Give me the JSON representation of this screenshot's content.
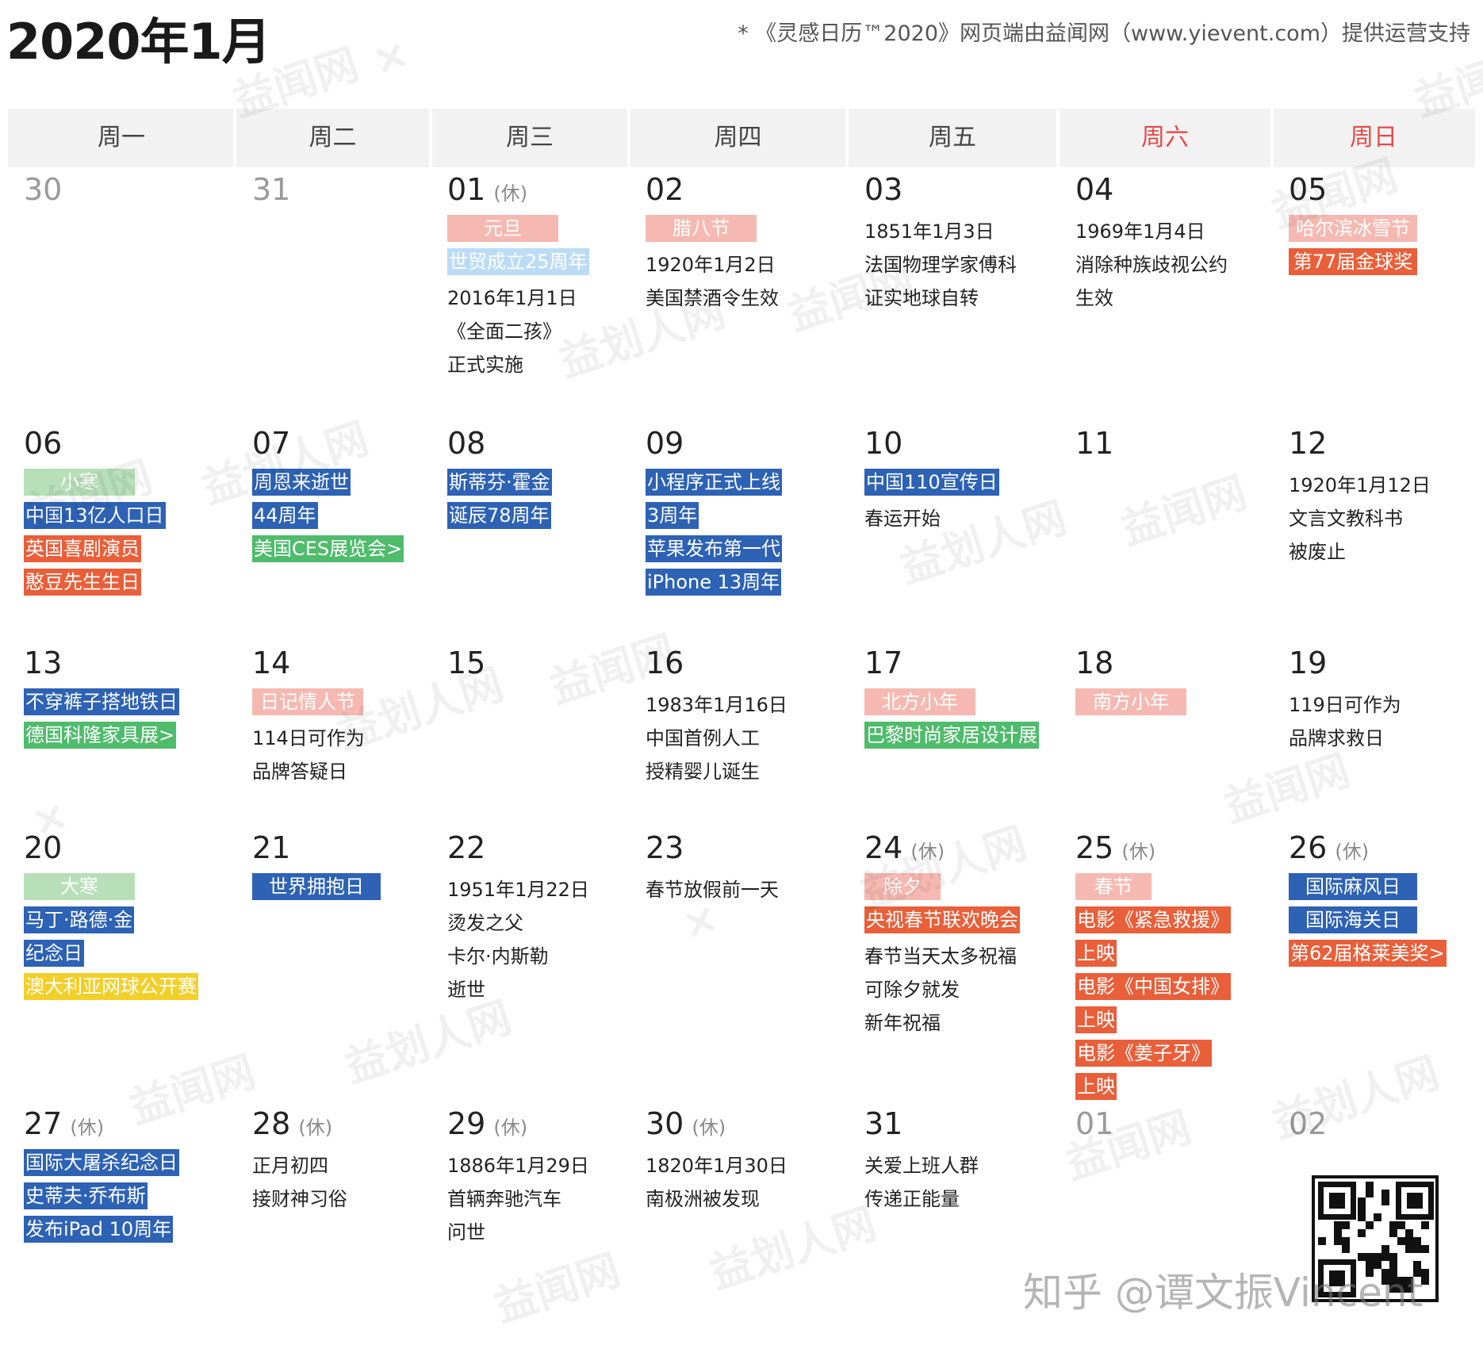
{
  "header": {
    "title": "2020年1月",
    "credit": "* 《灵感日历™2020》网页端由益闻网（www.yievent.com）提供运营支持"
  },
  "colors": {
    "red_tag": "#e95f3a",
    "pink_tag": "#f6b9b2",
    "blue_tag": "#2d62b5",
    "light_blue_tag": "#bcdcf5",
    "green_tag": "#4fbc6c",
    "light_green_tag": "#b7e0b8",
    "yellow_tag": "#f3cf2a",
    "weekend_header": "#e64a4a"
  },
  "weekdays": [
    "周一",
    "周二",
    "周三",
    "周四",
    "周五",
    "周六",
    "周日"
  ],
  "holiday_mark": "(休)",
  "weeks": [
    {
      "days": [
        {
          "num": "30",
          "other": true,
          "items": []
        },
        {
          "num": "31",
          "other": true,
          "items": []
        },
        {
          "num": "01",
          "holiday": true,
          "items": [
            {
              "type": "tag",
              "text": "元旦",
              "color": "#f6b9b2",
              "center": true
            },
            {
              "type": "tag",
              "text": "世贸成立25周年",
              "color": "#bcdcf5"
            },
            {
              "type": "note",
              "text": "2016年1月1日"
            },
            {
              "type": "note",
              "text": "《全面二孩》"
            },
            {
              "type": "note",
              "text": "正式实施"
            }
          ]
        },
        {
          "num": "02",
          "items": [
            {
              "type": "tag",
              "text": "腊八节",
              "color": "#f6b9b2",
              "center": true
            },
            {
              "type": "note",
              "text": "1920年1月2日"
            },
            {
              "type": "note",
              "text": "美国禁酒令生效"
            }
          ]
        },
        {
          "num": "03",
          "items": [
            {
              "type": "note",
              "text": "1851年1月3日"
            },
            {
              "type": "note",
              "text": "法国物理学家傅科"
            },
            {
              "type": "note",
              "text": "证实地球自转"
            }
          ]
        },
        {
          "num": "04",
          "items": [
            {
              "type": "note",
              "text": "1969年1月4日"
            },
            {
              "type": "note",
              "text": "消除种族歧视公约"
            },
            {
              "type": "note",
              "text": "生效"
            }
          ]
        },
        {
          "num": "05",
          "items": [
            {
              "type": "tag",
              "text": "哈尔滨冰雪节",
              "color": "#f6b9b2",
              "center": true,
              "wide": true
            },
            {
              "type": "tag",
              "text": "第77届金球奖",
              "color": "#e95f3a",
              "center": true,
              "wide": true
            }
          ]
        }
      ]
    },
    {
      "days": [
        {
          "num": "06",
          "items": [
            {
              "type": "tag",
              "text": "小寒",
              "color": "#b7e0b8",
              "center": true
            },
            {
              "type": "tag",
              "text": "中国13亿人口日",
              "color": "#2d62b5"
            },
            {
              "type": "tag",
              "text": "英国喜剧演员",
              "color": "#e95f3a"
            },
            {
              "type": "tag",
              "text": "憨豆先生生日",
              "color": "#e95f3a"
            }
          ]
        },
        {
          "num": "07",
          "items": [
            {
              "type": "tag",
              "text": "周恩来逝世",
              "color": "#2d62b5"
            },
            {
              "type": "tag",
              "text": "44周年",
              "color": "#2d62b5"
            },
            {
              "type": "tag",
              "text": "美国CES展览会>",
              "color": "#4fbc6c"
            }
          ]
        },
        {
          "num": "08",
          "items": [
            {
              "type": "tag",
              "text": "斯蒂芬·霍金",
              "color": "#2d62b5"
            },
            {
              "type": "tag",
              "text": "诞辰78周年",
              "color": "#2d62b5"
            }
          ]
        },
        {
          "num": "09",
          "items": [
            {
              "type": "tag",
              "text": "小程序正式上线",
              "color": "#2d62b5"
            },
            {
              "type": "tag",
              "text": "3周年",
              "color": "#2d62b5"
            },
            {
              "type": "tag",
              "text": "苹果发布第一代",
              "color": "#2d62b5"
            },
            {
              "type": "tag",
              "text": "iPhone 13周年",
              "color": "#2d62b5"
            }
          ]
        },
        {
          "num": "10",
          "items": [
            {
              "type": "tag",
              "text": "中国110宣传日",
              "color": "#2d62b5"
            },
            {
              "type": "note",
              "text": "春运开始"
            }
          ]
        },
        {
          "num": "11",
          "items": []
        },
        {
          "num": "12",
          "items": [
            {
              "type": "note",
              "text": "1920年1月12日"
            },
            {
              "type": "note",
              "text": "文言文教科书"
            },
            {
              "type": "note",
              "text": "被废止"
            }
          ]
        }
      ]
    },
    {
      "days": [
        {
          "num": "13",
          "items": [
            {
              "type": "tag",
              "text": "不穿裤子搭地铁日",
              "color": "#2d62b5"
            },
            {
              "type": "tag",
              "text": "德国科隆家具展>",
              "color": "#4fbc6c"
            }
          ]
        },
        {
          "num": "14",
          "items": [
            {
              "type": "tag",
              "text": "日记情人节",
              "color": "#f6b9b2",
              "center": true
            },
            {
              "type": "note",
              "text": "114日可作为"
            },
            {
              "type": "note",
              "text": "品牌答疑日"
            }
          ]
        },
        {
          "num": "15",
          "items": []
        },
        {
          "num": "16",
          "items": [
            {
              "type": "note",
              "text": "1983年1月16日"
            },
            {
              "type": "note",
              "text": "中国首例人工"
            },
            {
              "type": "note",
              "text": "授精婴儿诞生"
            }
          ]
        },
        {
          "num": "17",
          "items": [
            {
              "type": "tag",
              "text": "北方小年",
              "color": "#f6b9b2",
              "center": true
            },
            {
              "type": "tag",
              "text": "巴黎时尚家居设计展",
              "color": "#4fbc6c"
            }
          ]
        },
        {
          "num": "18",
          "items": [
            {
              "type": "tag",
              "text": "南方小年",
              "color": "#f6b9b2",
              "center": true
            }
          ]
        },
        {
          "num": "19",
          "items": [
            {
              "type": "note",
              "text": "119日可作为"
            },
            {
              "type": "note",
              "text": "品牌求救日"
            }
          ]
        }
      ]
    },
    {
      "days": [
        {
          "num": "20",
          "items": [
            {
              "type": "tag",
              "text": "大寒",
              "color": "#b7e0b8",
              "center": true
            },
            {
              "type": "tag",
              "text": "马丁·路德·金",
              "color": "#2d62b5"
            },
            {
              "type": "tag",
              "text": "纪念日",
              "color": "#2d62b5"
            },
            {
              "type": "tag",
              "text": "澳大利亚网球公开赛",
              "color": "#f3cf2a"
            }
          ]
        },
        {
          "num": "21",
          "items": [
            {
              "type": "tag",
              "text": "世界拥抱日",
              "color": "#2d62b5",
              "center": true,
              "wide": true
            }
          ]
        },
        {
          "num": "22",
          "items": [
            {
              "type": "note",
              "text": "1951年1月22日"
            },
            {
              "type": "note",
              "text": "烫发之父"
            },
            {
              "type": "note",
              "text": "卡尔·内斯勒"
            },
            {
              "type": "note",
              "text": "逝世"
            }
          ]
        },
        {
          "num": "23",
          "items": [
            {
              "type": "note",
              "text": "春节放假前一天"
            }
          ]
        },
        {
          "num": "24",
          "holiday": true,
          "items": [
            {
              "type": "tag",
              "text": "除夕",
              "color": "#f6b9b2",
              "center": true,
              "narrow": true
            },
            {
              "type": "tag",
              "text": "央视春节联欢晚会",
              "color": "#e95f3a"
            },
            {
              "type": "note",
              "text": "春节当天太多祝福"
            },
            {
              "type": "note",
              "text": "可除夕就发"
            },
            {
              "type": "note",
              "text": "新年祝福"
            }
          ]
        },
        {
          "num": "25",
          "holiday": true,
          "items": [
            {
              "type": "tag",
              "text": "春节",
              "color": "#f6b9b2",
              "center": true,
              "narrow": true
            },
            {
              "type": "tag",
              "text": "电影《紧急救援》",
              "color": "#e95f3a"
            },
            {
              "type": "tag",
              "text": "上映",
              "color": "#e95f3a"
            },
            {
              "type": "tag",
              "text": "电影《中国女排》",
              "color": "#e95f3a"
            },
            {
              "type": "tag",
              "text": "上映",
              "color": "#e95f3a"
            },
            {
              "type": "tag",
              "text": "电影《姜子牙》",
              "color": "#e95f3a"
            },
            {
              "type": "tag",
              "text": "上映",
              "color": "#e95f3a"
            }
          ]
        },
        {
          "num": "26",
          "holiday": true,
          "items": [
            {
              "type": "tag",
              "text": "国际麻风日",
              "color": "#2d62b5",
              "center": true,
              "wide": true
            },
            {
              "type": "tag",
              "text": "国际海关日",
              "color": "#2d62b5",
              "center": true,
              "wide": true
            },
            {
              "type": "tag",
              "text": "第62届格莱美奖>",
              "color": "#e95f3a"
            }
          ]
        }
      ]
    },
    {
      "days": [
        {
          "num": "27",
          "holiday": true,
          "items": [
            {
              "type": "tag",
              "text": "国际大屠杀纪念日",
              "color": "#2d62b5"
            },
            {
              "type": "tag",
              "text": "史蒂夫·乔布斯",
              "color": "#2d62b5"
            },
            {
              "type": "tag",
              "text": "发布iPad 10周年",
              "color": "#2d62b5"
            }
          ]
        },
        {
          "num": "28",
          "holiday": true,
          "items": [
            {
              "type": "note",
              "text": "正月初四"
            },
            {
              "type": "note",
              "text": "接财神习俗"
            }
          ]
        },
        {
          "num": "29",
          "holiday": true,
          "items": [
            {
              "type": "note",
              "text": "1886年1月29日"
            },
            {
              "type": "note",
              "text": "首辆奔驰汽车"
            },
            {
              "type": "note",
              "text": "问世"
            }
          ]
        },
        {
          "num": "30",
          "holiday": true,
          "items": [
            {
              "type": "note",
              "text": "1820年1月30日"
            },
            {
              "type": "note",
              "text": "南极洲被发现"
            }
          ]
        },
        {
          "num": "31",
          "items": [
            {
              "type": "note",
              "text": "关爱上班人群"
            },
            {
              "type": "note",
              "text": "传递正能量"
            }
          ]
        },
        {
          "num": "01",
          "other": true,
          "items": []
        },
        {
          "num": "02",
          "other": true,
          "items": []
        }
      ]
    }
  ],
  "watermarks": [
    "益闻网",
    "×",
    "益划人网",
    "益闻网",
    "益划人网",
    "益闻网",
    "益划人网",
    "益闻网",
    "益划人网",
    "益闻网"
  ],
  "footer": {
    "zhihu": "知乎 @谭文振Vincent"
  }
}
